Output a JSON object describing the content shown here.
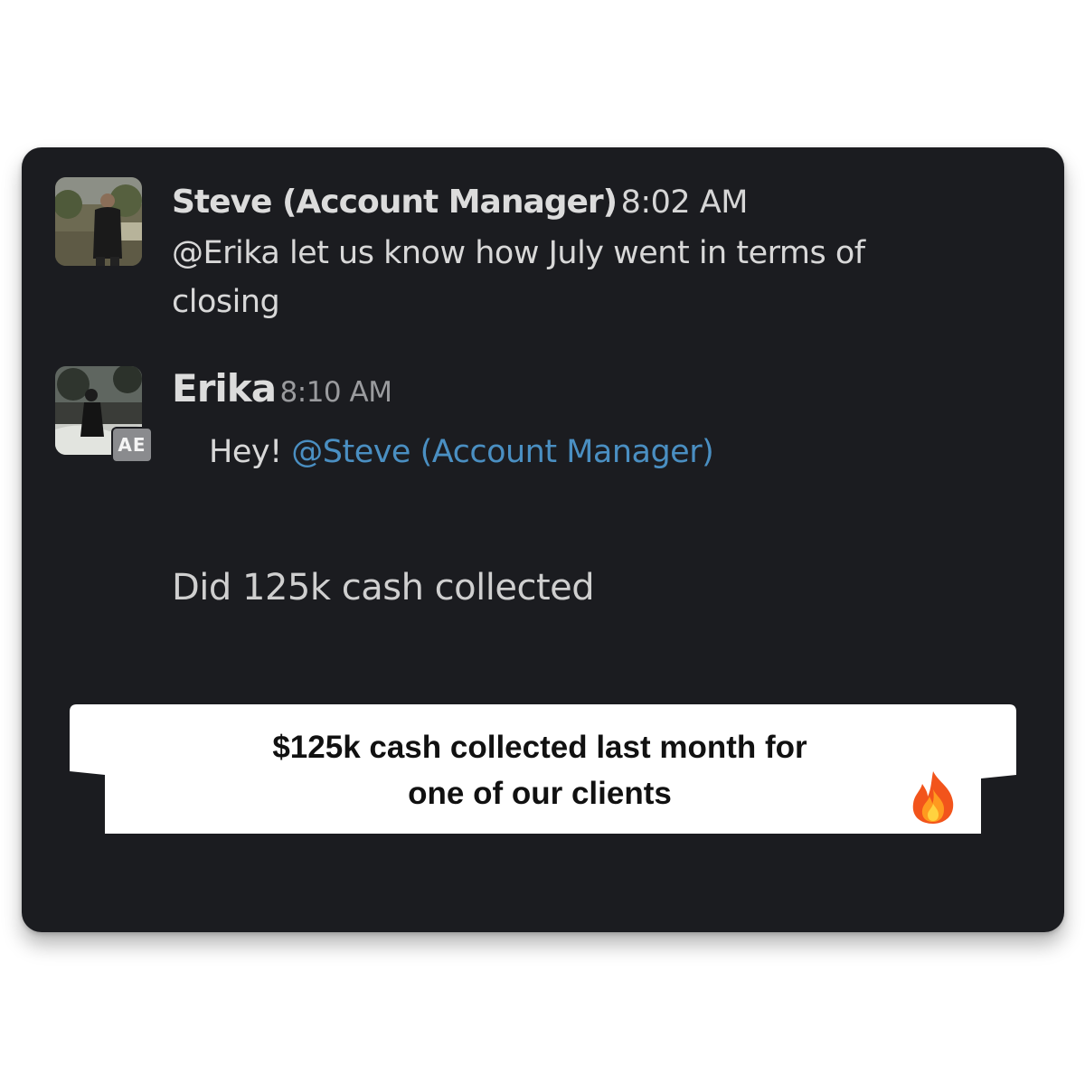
{
  "messages": [
    {
      "author": "Steve (Account Manager)",
      "time": "8:02 AM",
      "text": "@Erika let us know how July went in terms of closing"
    },
    {
      "author": "Erika",
      "time": "8:10 AM",
      "badge": "AE",
      "greeting": "Hey!",
      "mention": "@Steve (Account Manager)",
      "text": "Did 125k cash collected"
    }
  ],
  "banner": {
    "line1": "$125k cash collected last month for",
    "line2": "one of our  clients",
    "icon": "fire-icon"
  }
}
